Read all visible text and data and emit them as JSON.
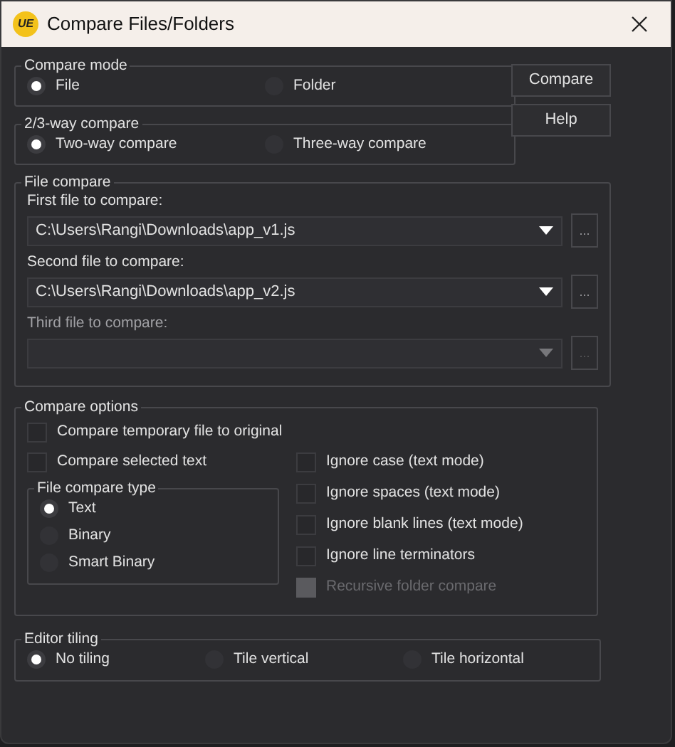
{
  "window": {
    "logo": "UE",
    "title": "Compare Files/Folders"
  },
  "compare_mode": {
    "label": "Compare mode",
    "options": [
      {
        "label": "File",
        "selected": true
      },
      {
        "label": "Folder",
        "selected": false
      }
    ]
  },
  "way_compare": {
    "label": "2/3-way compare",
    "options": [
      {
        "label": "Two-way compare",
        "selected": true
      },
      {
        "label": "Three-way compare",
        "selected": false
      }
    ]
  },
  "buttons": [
    "Compare",
    "Help"
  ],
  "file_compare": {
    "label": "File compare",
    "fields": [
      {
        "label": "First file to compare:",
        "value": "C:\\Users\\Rangi\\Downloads\\app_v1.js",
        "disabled": false,
        "browse": "..."
      },
      {
        "label": "Second file to compare:",
        "value": "C:\\Users\\Rangi\\Downloads\\app_v2.js",
        "disabled": false,
        "browse": "..."
      },
      {
        "label": "Third file to compare:",
        "disabled": true,
        "browse": "..."
      }
    ]
  },
  "compare_options": {
    "label": "Compare options",
    "top_checks": [
      {
        "label": "Compare temporary file to original",
        "checked": false
      },
      {
        "label": "Compare selected text",
        "checked": false
      }
    ],
    "file_compare_type": {
      "label": "File compare type",
      "options": [
        {
          "label": "Text",
          "selected": true
        },
        {
          "label": "Binary",
          "selected": false
        },
        {
          "label": "Smart Binary",
          "selected": false
        }
      ]
    },
    "right_checks": [
      {
        "label": "Ignore case (text mode)",
        "checked": false,
        "disabled": false
      },
      {
        "label": "Ignore spaces (text mode)",
        "checked": false,
        "disabled": false
      },
      {
        "label": "Ignore blank lines (text mode)",
        "checked": false,
        "disabled": false
      },
      {
        "label": "Ignore line terminators",
        "checked": false,
        "disabled": false
      },
      {
        "label": "Recursive folder compare",
        "checked": false,
        "disabled": true
      }
    ]
  },
  "editor_tiling": {
    "label": "Editor tiling",
    "options": [
      {
        "label": "No tiling",
        "selected": true
      },
      {
        "label": "Tile vertical",
        "selected": false
      },
      {
        "label": "Tile horizontal",
        "selected": false
      }
    ]
  }
}
